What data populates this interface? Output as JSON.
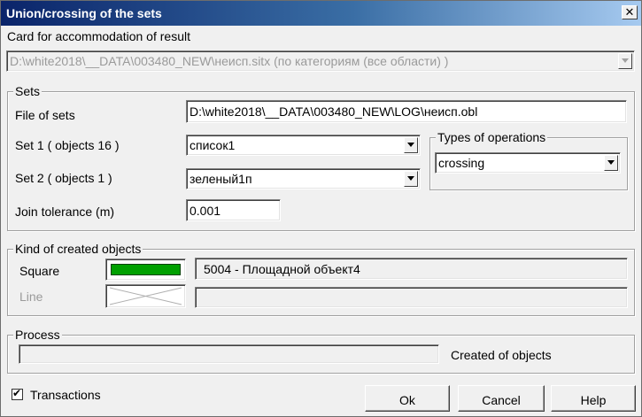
{
  "window": {
    "title": "Union/crossing of the sets",
    "close_glyph": "✕"
  },
  "card": {
    "label": "Card for accommodation of result",
    "value": "D:\\white2018\\__DATA\\003480_NEW\\неисп.sitx (по категориям (все области) )"
  },
  "sets": {
    "group_title": "Sets",
    "file_label": "File of sets",
    "file_value": "D:\\white2018\\__DATA\\003480_NEW\\LOG\\неисп.obl",
    "set1_label": "Set 1  ( objects 16 )",
    "set1_value": "список1",
    "set2_label": "Set 2  ( objects 1 )",
    "set2_value": "зеленый1п",
    "tolerance_label": "Join tolerance (m)",
    "tolerance_value": "0.001",
    "operations_title": "Types of operations",
    "operation_value": "crossing"
  },
  "kind": {
    "group_title": "Kind of created objects",
    "square_label": "Square",
    "square_color": "#00a000",
    "square_desc": "5004  -  Площадной объект4",
    "line_label": "Line",
    "line_desc": ""
  },
  "process": {
    "group_title": "Process",
    "progress": 0,
    "created_label": "Created of objects"
  },
  "footer": {
    "transactions_label": "Transactions",
    "transactions_checked": true,
    "check_glyph": "✔",
    "ok_label": "Ok",
    "cancel_label": "Cancel",
    "help_label": "Help"
  }
}
